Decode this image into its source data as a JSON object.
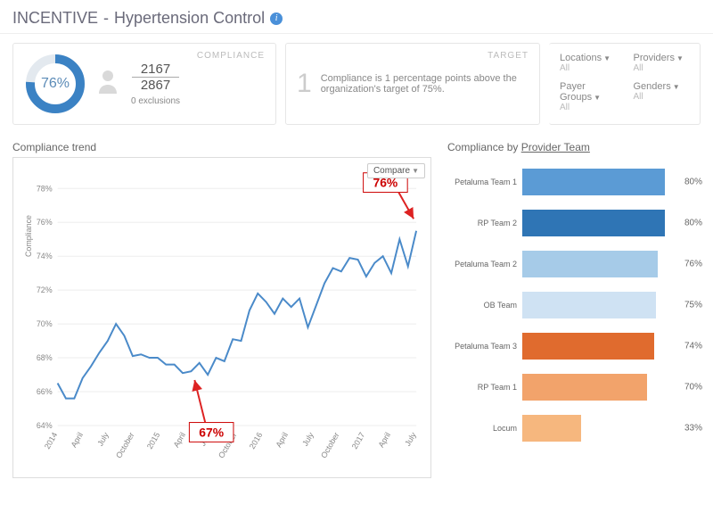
{
  "title_prefix": "INCENTIVE",
  "title_main": "Hypertension Control",
  "compliance": {
    "label": "COMPLIANCE",
    "percent_text": "76%",
    "percent": 76,
    "numerator": "2167",
    "denominator": "2867",
    "exclusions": "0 exclusions"
  },
  "target": {
    "label": "TARGET",
    "delta": "1",
    "text": "Compliance is 1 percentage points above the organization's target of 75%."
  },
  "filters": [
    {
      "label": "Locations",
      "value": "All"
    },
    {
      "label": "Providers",
      "value": "All"
    },
    {
      "label": "Payer Groups",
      "value": "All"
    },
    {
      "label": "Genders",
      "value": "All"
    }
  ],
  "trend": {
    "title": "Compliance trend",
    "compare": "Compare",
    "y_axis_label": "Compliance",
    "callout_low": "67%",
    "callout_high": "76%"
  },
  "byteam": {
    "title_prefix": "Compliance by ",
    "title_link": "Provider Team"
  },
  "chart_data": {
    "trend": {
      "type": "line",
      "ylabel": "Compliance",
      "ylim": [
        64,
        78
      ],
      "y_ticks": [
        "64%",
        "66%",
        "68%",
        "70%",
        "72%",
        "74%",
        "76%",
        "78%"
      ],
      "x_ticks": [
        "2014",
        "April",
        "July",
        "October",
        "2015",
        "April",
        "July",
        "October",
        "2016",
        "April",
        "July",
        "October",
        "2017",
        "April",
        "July"
      ],
      "values": [
        66.5,
        65.6,
        65.6,
        66.8,
        67.5,
        68.3,
        69.0,
        70.0,
        69.3,
        68.1,
        68.2,
        68.0,
        68.0,
        67.6,
        67.6,
        67.1,
        67.2,
        67.7,
        67.0,
        68.0,
        67.8,
        69.1,
        69.0,
        70.8,
        71.8,
        71.3,
        70.6,
        71.5,
        71.0,
        71.5,
        69.8,
        71.1,
        72.4,
        73.3,
        73.1,
        73.9,
        73.8,
        72.8,
        73.6,
        74.0,
        73.0,
        75.0,
        73.4,
        75.5
      ],
      "callouts": [
        {
          "index": 16,
          "value": 67,
          "label": "67%"
        },
        {
          "index": 43,
          "value": 76,
          "label": "76%"
        }
      ]
    },
    "by_team": {
      "type": "bar",
      "xlim": [
        0,
        100
      ],
      "series": [
        {
          "name": "Petaluma Team 1",
          "value": 80,
          "color": "#5b9bd5"
        },
        {
          "name": "RP Team 2",
          "value": 80,
          "color": "#2f75b5"
        },
        {
          "name": "Petaluma Team 2",
          "value": 76,
          "color": "#a6cbe8"
        },
        {
          "name": "OB Team",
          "value": 75,
          "color": "#cfe2f3"
        },
        {
          "name": "Petaluma Team 3",
          "value": 74,
          "color": "#e06b2e"
        },
        {
          "name": "RP Team 1",
          "value": 70,
          "color": "#f2a36b"
        },
        {
          "name": "Locum",
          "value": 33,
          "color": "#f6b77e"
        }
      ]
    }
  }
}
